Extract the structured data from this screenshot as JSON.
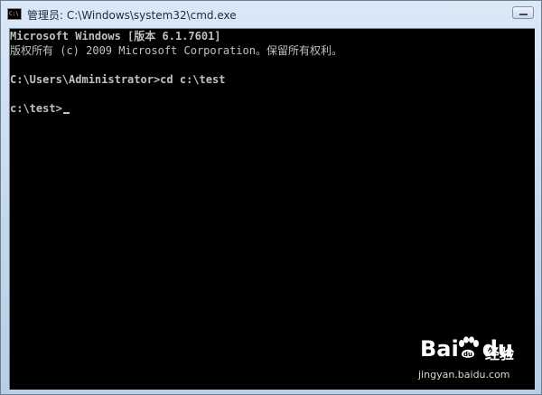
{
  "window": {
    "title": "管理员: C:\\Windows\\system32\\cmd.exe",
    "icon_text": "C:\\"
  },
  "console": {
    "lines": [
      "Microsoft Windows [版本 6.1.7601]",
      "版权所有 (c) 2009 Microsoft Corporation。保留所有权利。",
      "C:\\Users\\Administrator>cd c:\\test",
      "c:\\test>"
    ]
  },
  "watermark": {
    "logo_left": "Bai",
    "logo_right": "du",
    "jingyan": "经验",
    "url": "jingyan.baidu.com"
  },
  "icons": [
    "cmd-app-icon",
    "minimize-icon",
    "baidu-paw-icon"
  ],
  "colors": {
    "console_bg": "#000000",
    "console_text": "#c0c0c0",
    "titlebar": "#c3d6ea"
  }
}
